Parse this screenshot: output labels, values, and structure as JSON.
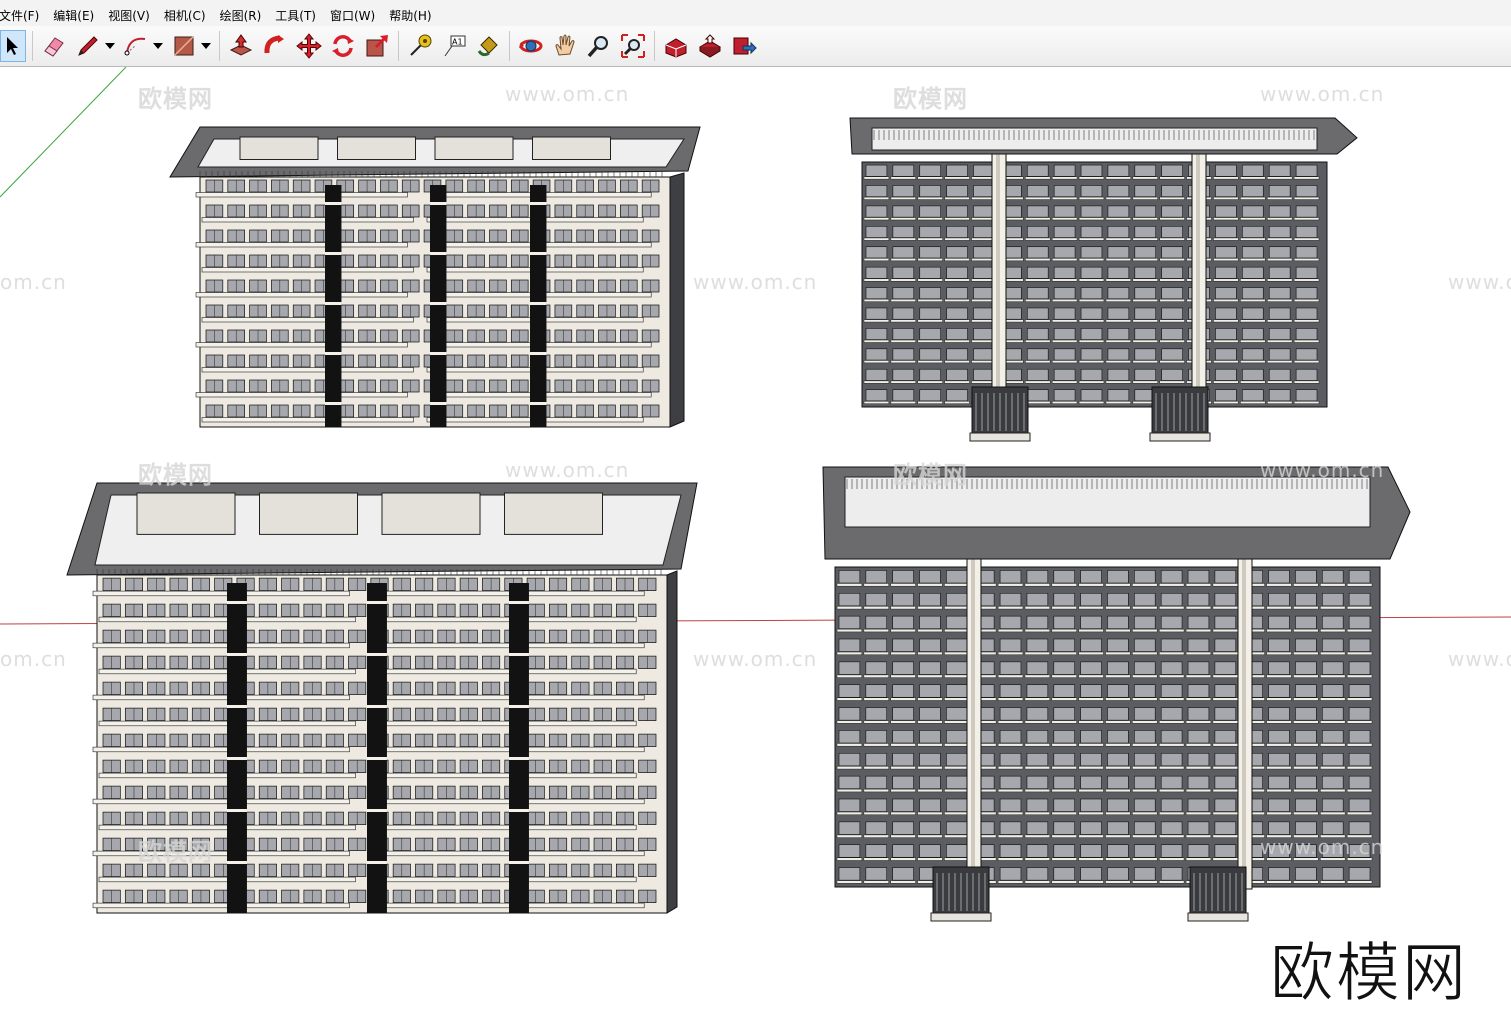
{
  "menubar": {
    "items": [
      {
        "label": "文件(F)"
      },
      {
        "label": "编辑(E)"
      },
      {
        "label": "视图(V)"
      },
      {
        "label": "相机(C)"
      },
      {
        "label": "绘图(R)"
      },
      {
        "label": "工具(T)"
      },
      {
        "label": "窗口(W)"
      },
      {
        "label": "帮助(H)"
      }
    ]
  },
  "toolbar": {
    "text_tool_glyph": "A1",
    "tools": [
      {
        "icon": "select-arrow-icon",
        "selected": true
      },
      {
        "icon": "eraser-icon"
      },
      {
        "icon": "pencil-line-icon",
        "dropdown": true
      },
      {
        "icon": "arc-icon",
        "dropdown": true
      },
      {
        "icon": "rectangle-icon",
        "dropdown": true
      },
      {
        "icon": "push-pull-icon"
      },
      {
        "icon": "follow-me-icon"
      },
      {
        "icon": "move-icon"
      },
      {
        "icon": "rotate-icon"
      },
      {
        "icon": "scale-icon"
      },
      {
        "icon": "tape-measure-icon"
      },
      {
        "icon": "text-icon"
      },
      {
        "icon": "paint-bucket-icon"
      },
      {
        "icon": "orbit-icon"
      },
      {
        "icon": "pan-hand-icon"
      },
      {
        "icon": "zoom-icon"
      },
      {
        "icon": "zoom-extents-icon"
      },
      {
        "icon": "warehouse-icon"
      },
      {
        "icon": "share-model-icon"
      },
      {
        "icon": "extension-icon"
      }
    ]
  },
  "viewport": {
    "watermark_cn": "欧模网",
    "watermark_url": "www.om.cn",
    "watermark_short": "om.cn",
    "logo_text": "欧模网",
    "colors": {
      "roof": "#6b6b6e",
      "wall": "#eeeae2",
      "window": "#a6a8ad",
      "glass": "#5a5c62",
      "shaft": "#121212",
      "axis_green": "#3aa53a",
      "axis_red": "#c04040"
    }
  }
}
